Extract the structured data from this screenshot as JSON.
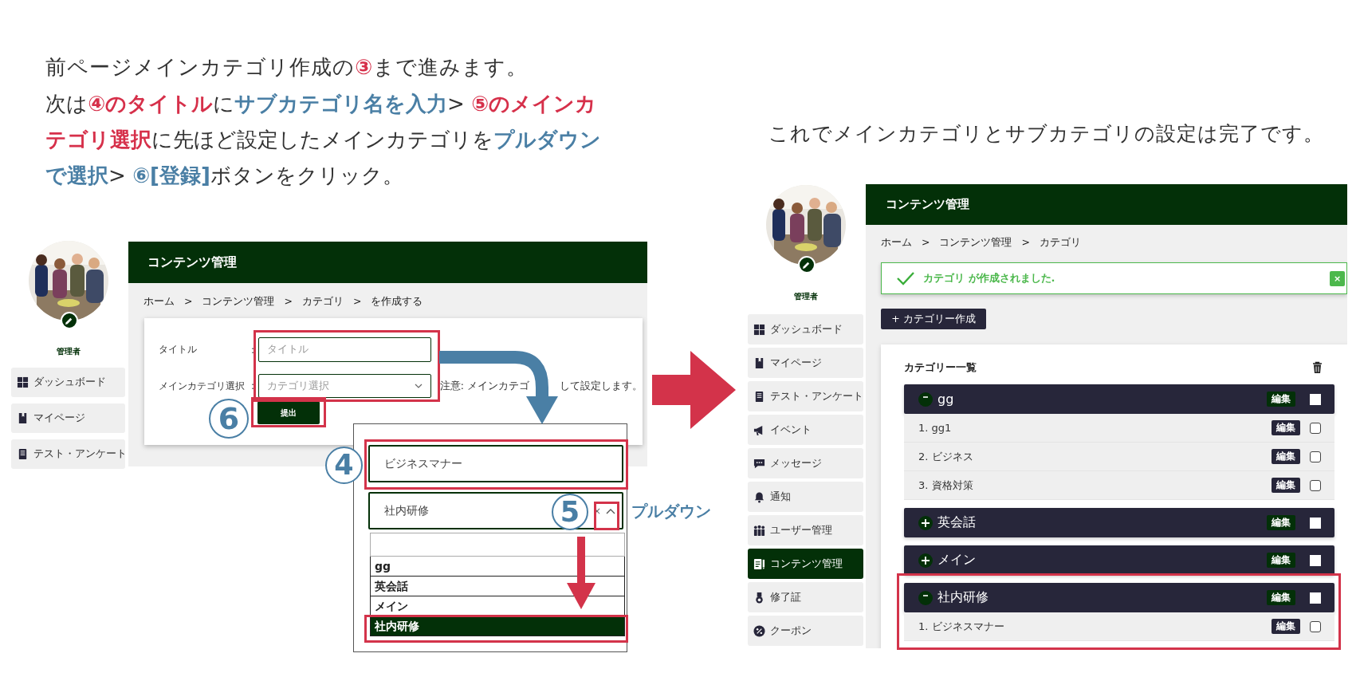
{
  "instructions": {
    "lead": [
      {
        "kind": "plain",
        "text": "前ページメインカテゴリ作成の"
      },
      {
        "kind": "red",
        "text": "③"
      },
      {
        "kind": "plain",
        "text": "まで進みます。"
      }
    ],
    "lines": [
      [
        {
          "kind": "plain",
          "text": "次は"
        },
        {
          "kind": "red",
          "text": "④のタイトル"
        },
        {
          "kind": "plain",
          "text": "に"
        },
        {
          "kind": "blue",
          "text": "サブカテゴリ名を入力"
        },
        {
          "kind": "plain",
          "text": "> "
        },
        {
          "kind": "red",
          "text": "⑤のメインカ"
        }
      ],
      [
        {
          "kind": "red",
          "text": "テゴリ選択"
        },
        {
          "kind": "plain",
          "text": "に先ほど設定したメインカテゴリを"
        },
        {
          "kind": "blue",
          "text": "プルダウン"
        }
      ],
      [
        {
          "kind": "blue",
          "text": "で選択"
        },
        {
          "kind": "plain",
          "text": "> "
        },
        {
          "kind": "blue",
          "text": "⑥[登録]"
        },
        {
          "kind": "plain",
          "text": "ボタンをクリック。"
        }
      ]
    ]
  },
  "caption": "これでメインカテゴリとサブカテゴリの設定は完了です。",
  "before": {
    "sidebar": {
      "user_name": "管理者",
      "items": [
        {
          "kind": "dashboard",
          "label": "ダッシュボード",
          "selected": false
        },
        {
          "kind": "mypage",
          "label": "マイページ",
          "selected": false
        },
        {
          "kind": "test",
          "label": "テスト・アンケート",
          "selected": false
        }
      ]
    },
    "header": "コンテンツ管理",
    "breadcrumb": {
      "separator": ">",
      "items": [
        "ホーム",
        "コンテンツ管理",
        "カテゴリ",
        "を作成する"
      ]
    },
    "form": {
      "fields": [
        {
          "kind": "text",
          "label": "タイトル",
          "colon": ":",
          "placeholder": "タイトル"
        },
        {
          "kind": "select",
          "label": "メインカテゴリ選択",
          "colon": ":",
          "placeholder": "カテゴリ選択"
        }
      ],
      "note_parts": [
        "注意: メインカテゴ",
        "して設定します。"
      ],
      "submit": "提出",
      "submit_step": "6"
    }
  },
  "zoom": {
    "title_value": "ビジネスマナー",
    "title_step": "4",
    "select_value": "社内研修",
    "select_step": "5",
    "clear": "×",
    "callout": "プルダウン",
    "options": [
      {
        "label": "gg",
        "selected": false
      },
      {
        "label": "英会話",
        "selected": false
      },
      {
        "label": "メイン",
        "selected": false
      },
      {
        "label": "社内研修",
        "selected": true
      }
    ]
  },
  "after": {
    "sidebar": {
      "user_name": "管理者",
      "items": [
        {
          "kind": "dashboard",
          "label": "ダッシュボード",
          "selected": false
        },
        {
          "kind": "mypage",
          "label": "マイページ",
          "selected": false
        },
        {
          "kind": "test",
          "label": "テスト・アンケート",
          "selected": false
        },
        {
          "kind": "event",
          "label": "イベント",
          "selected": false
        },
        {
          "kind": "message",
          "label": "メッセージ",
          "selected": false
        },
        {
          "kind": "notice",
          "label": "通知",
          "selected": false
        },
        {
          "kind": "users",
          "label": "ユーザー管理",
          "selected": false
        },
        {
          "kind": "content",
          "label": "コンテンツ管理",
          "selected": true
        },
        {
          "kind": "certificate",
          "label": "修了証",
          "selected": false
        },
        {
          "kind": "coupon",
          "label": "クーポン",
          "selected": false
        }
      ]
    },
    "header": "コンテンツ管理",
    "breadcrumb": {
      "separator": ">",
      "items": [
        "ホーム",
        "コンテンツ管理",
        "カテゴリ"
      ]
    },
    "alert": {
      "message": "カテゴリ が作成されました.",
      "close": "×"
    },
    "create_button": "+ カテゴリー作成",
    "list": {
      "title": "カテゴリー一覧",
      "groups": [
        {
          "name": "gg",
          "expanded": true,
          "edit": "編集",
          "checked": false,
          "children": [
            {
              "number": "1.",
              "name": "gg1",
              "edit": "編集",
              "checked": false
            },
            {
              "number": "2.",
              "name": "ビジネス",
              "edit": "編集",
              "checked": false
            },
            {
              "number": "3.",
              "name": "資格対策",
              "edit": "編集",
              "checked": false
            }
          ]
        },
        {
          "name": "英会話",
          "expanded": false,
          "edit": "編集",
          "checked": false
        },
        {
          "name": "メイン",
          "expanded": false,
          "edit": "編集",
          "checked": false
        },
        {
          "name": "社内研修",
          "expanded": true,
          "edit": "編集",
          "checked": false,
          "children": [
            {
              "number": "1.",
              "name": "ビジネスマナー",
              "edit": "編集",
              "checked": false
            }
          ]
        }
      ]
    }
  }
}
